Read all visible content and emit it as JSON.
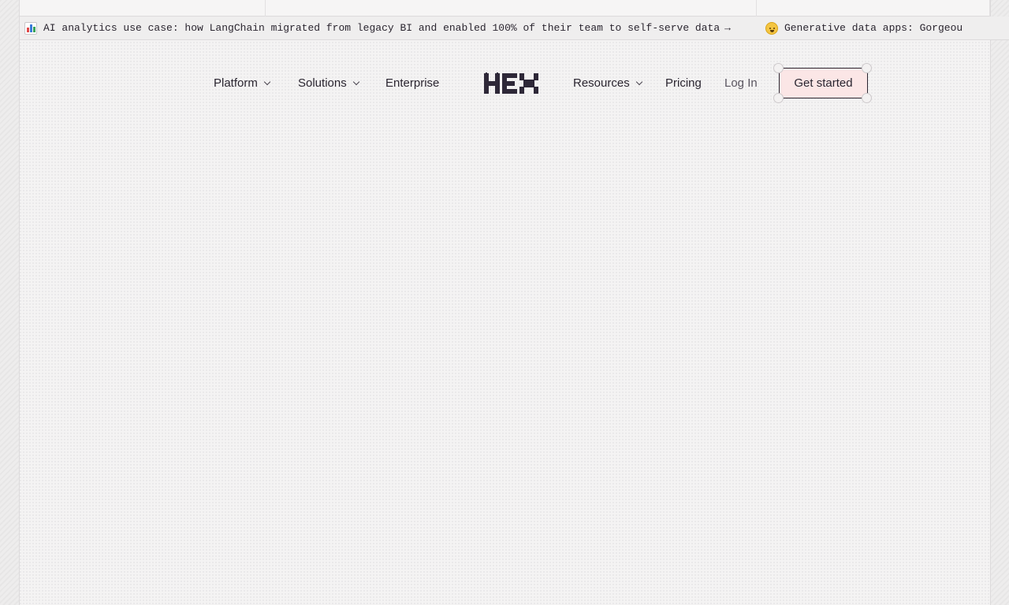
{
  "ticker": {
    "items": [
      {
        "icon": "bar-chart-emoji",
        "text": "AI analytics use case: how LangChain migrated from legacy BI and enabled 100% of their team to self-serve data",
        "arrow": "→"
      },
      {
        "icon": "exploding-head-emoji",
        "text": "Generative data apps: Gorgeou"
      }
    ]
  },
  "nav": {
    "platform": "Platform",
    "solutions": "Solutions",
    "enterprise": "Enterprise",
    "logo_text": "HEX",
    "resources": "Resources",
    "pricing": "Pricing",
    "login": "Log In",
    "get_started": "Get started"
  },
  "colors": {
    "background": "#f4f3f3",
    "text": "#2a2530",
    "cta_background": "#fbe6e6"
  }
}
